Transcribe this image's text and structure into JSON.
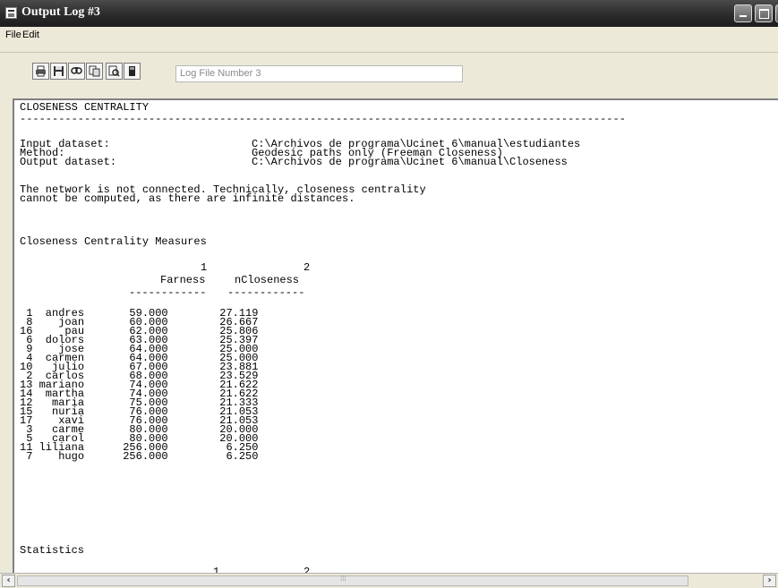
{
  "window": {
    "title": "Output Log #3",
    "icons": {
      "app": "app-icon",
      "minimize": "minimize-icon",
      "maximize": "maximize-icon",
      "close": "close-icon"
    }
  },
  "menu": {
    "items": [
      "File",
      "Edit"
    ]
  },
  "toolbar": {
    "buttons": [
      {
        "name": "print-icon"
      },
      {
        "name": "save-icon"
      },
      {
        "name": "find-icon"
      },
      {
        "name": "copy-icon"
      },
      {
        "name": "print-preview-icon"
      },
      {
        "name": "exit-icon"
      }
    ],
    "log_field_value": "Log File Number 3"
  },
  "output": {
    "heading": "CLOSENESS CENTRALITY",
    "rule": "----------------------------------------------------------------------------------------------",
    "input_label": "Input dataset:",
    "input_value": "C:\\Archivos de programa\\Ucinet 6\\manual\\estudiantes",
    "method_label": "Method:",
    "method_value": "Geodesic paths only (Freeman Closeness)",
    "output_label": "Output dataset:",
    "output_value": "C:\\Archivos de programa\\Ucinet 6\\manual\\Closeness",
    "note_line1": "The network is not connected. Technically, closeness centrality",
    "note_line2": "cannot be computed, as there are infinite distances.",
    "measures_title": "Closeness Centrality Measures",
    "col1_index": "1",
    "col2_index": "2",
    "col1_header": "Farness",
    "col2_header": "nCloseness",
    "col_rule": "------------",
    "rows": [
      {
        "id": "1",
        "name": "andres",
        "farness": "59.000",
        "ncloseness": "27.119"
      },
      {
        "id": "8",
        "name": "joan",
        "farness": "60.000",
        "ncloseness": "26.667"
      },
      {
        "id": "16",
        "name": "pau",
        "farness": "62.000",
        "ncloseness": "25.806"
      },
      {
        "id": "6",
        "name": "dolors",
        "farness": "63.000",
        "ncloseness": "25.397"
      },
      {
        "id": "9",
        "name": "jose",
        "farness": "64.000",
        "ncloseness": "25.000"
      },
      {
        "id": "4",
        "name": "carmen",
        "farness": "64.000",
        "ncloseness": "25.000"
      },
      {
        "id": "10",
        "name": "julio",
        "farness": "67.000",
        "ncloseness": "23.881"
      },
      {
        "id": "2",
        "name": "carlos",
        "farness": "68.000",
        "ncloseness": "23.529"
      },
      {
        "id": "13",
        "name": "mariano",
        "farness": "74.000",
        "ncloseness": "21.622"
      },
      {
        "id": "14",
        "name": "martha",
        "farness": "74.000",
        "ncloseness": "21.622"
      },
      {
        "id": "12",
        "name": "maria",
        "farness": "75.000",
        "ncloseness": "21.333"
      },
      {
        "id": "15",
        "name": "nuria",
        "farness": "76.000",
        "ncloseness": "21.053"
      },
      {
        "id": "17",
        "name": "xavi",
        "farness": "76.000",
        "ncloseness": "21.053"
      },
      {
        "id": "3",
        "name": "carme",
        "farness": "80.000",
        "ncloseness": "20.000"
      },
      {
        "id": "5",
        "name": "carol",
        "farness": "80.000",
        "ncloseness": "20.000"
      },
      {
        "id": "11",
        "name": "liliana",
        "farness": "256.000",
        "ncloseness": "6.250"
      },
      {
        "id": "7",
        "name": "hugo",
        "farness": "256.000",
        "ncloseness": "6.250"
      }
    ],
    "statistics_title": "Statistics",
    "stats_col1_index": "1",
    "stats_col2_index": "2"
  },
  "scrollbar": {
    "left_arrow": "‹",
    "right_arrow": "›"
  }
}
